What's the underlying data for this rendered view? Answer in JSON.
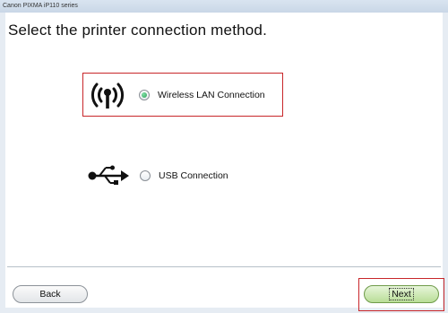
{
  "window": {
    "title": "Canon PIXMA iP110 series"
  },
  "page": {
    "heading": "Select the printer connection method."
  },
  "options": [
    {
      "label": "Wireless LAN Connection",
      "icon": "wireless-icon",
      "selected": true
    },
    {
      "label": "USB Connection",
      "icon": "usb-icon",
      "selected": false
    }
  ],
  "buttons": {
    "back_label": "Back",
    "next_label": "Next"
  },
  "colors": {
    "highlight": "#c8262a",
    "radio_selected": "#2f9f5a",
    "next_button": "#b9de97"
  }
}
